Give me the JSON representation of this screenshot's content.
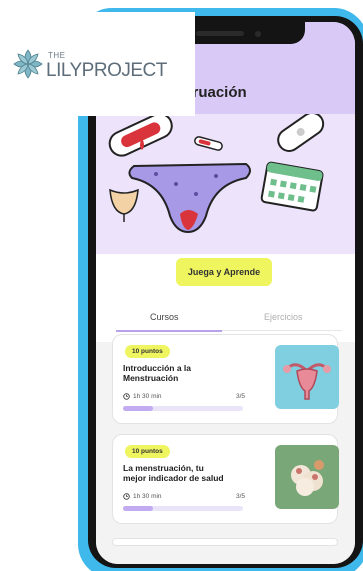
{
  "logo": {
    "prefix": "THE",
    "name": "LILYPROJECT"
  },
  "app": {
    "title": "nstruación"
  },
  "cta": {
    "label": "Juega y Aprende"
  },
  "tabs": [
    {
      "label": "Cursos",
      "active": true
    },
    {
      "label": "Ejercicios",
      "active": false
    }
  ],
  "courses": [
    {
      "badge": "10 puntos",
      "title_line1": "Introducción a la",
      "title_line2": "Menstruación",
      "duration": "1h 30 min",
      "count": "3/5",
      "progress": 0.25,
      "thumb_icon": "uterus-icon"
    },
    {
      "badge": "10 puntos",
      "title_line1": "La menstruación, tu",
      "title_line2": "mejor indicador de salud",
      "duration": "1h 30 min",
      "count": "3/5",
      "progress": 0.25,
      "thumb_icon": "flowers-icon"
    }
  ],
  "colors": {
    "frame": "#3fb8ec",
    "header": "#d9c9f7",
    "accent_yellow": "#eef55f",
    "progress": "#c2abf0"
  }
}
